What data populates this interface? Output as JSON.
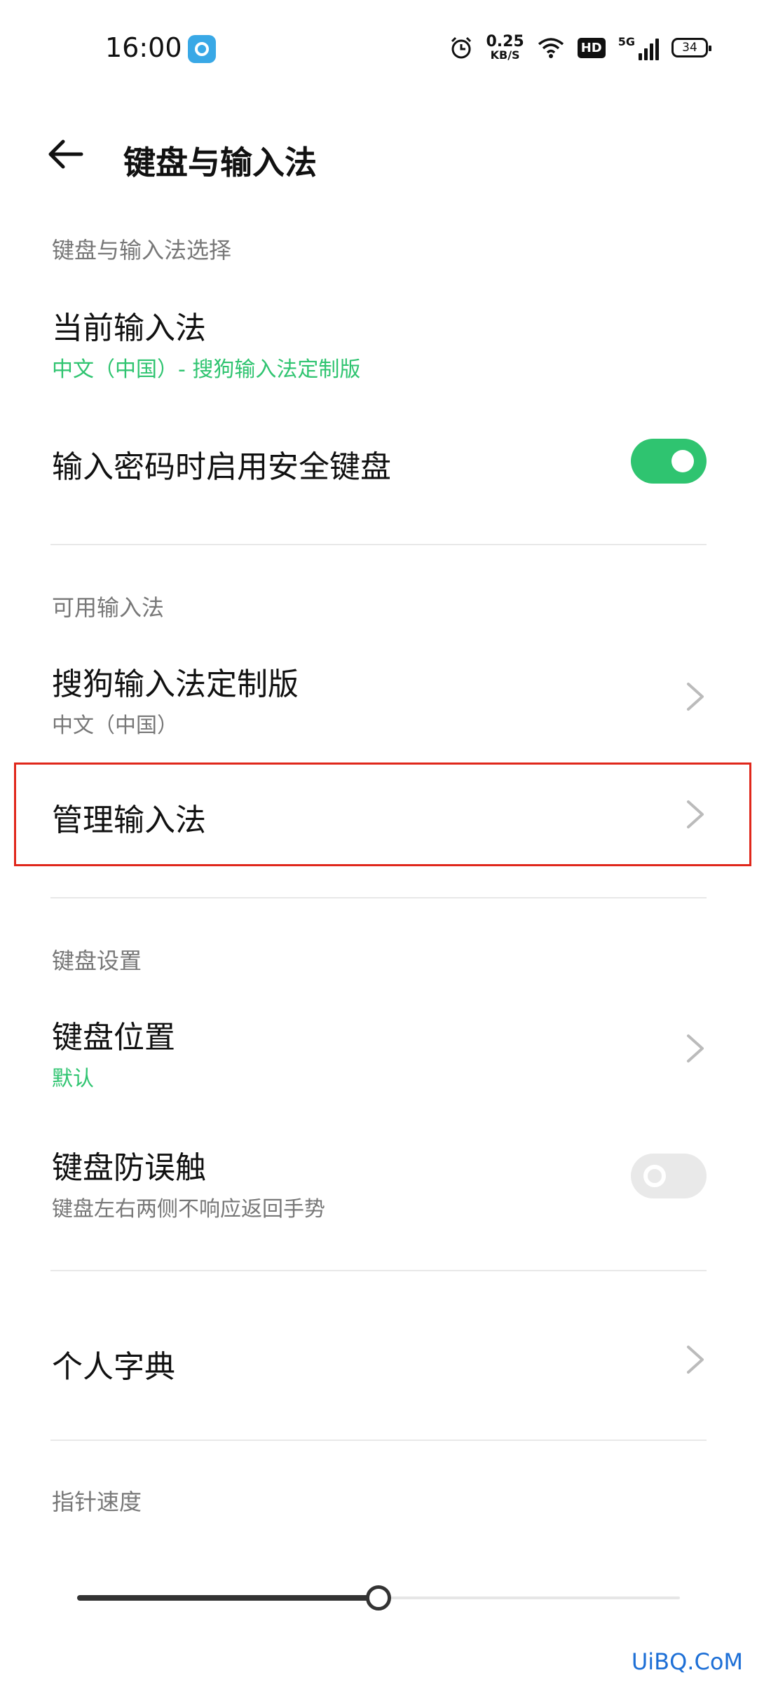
{
  "status_bar": {
    "time": "16:00",
    "net_speed_value": "0.25",
    "net_speed_unit": "KB/S",
    "hd_badge": "HD",
    "network_type": "5G",
    "battery": "34",
    "icons": [
      "alarm-icon",
      "wifi-icon",
      "hd-icon",
      "signal-icon",
      "battery-icon"
    ]
  },
  "header": {
    "title": "键盘与输入法"
  },
  "section_select": {
    "header": "键盘与输入法选择",
    "current_ime": {
      "title": "当前输入法",
      "subtitle": "中文（中国）- 搜狗输入法定制版"
    },
    "secure_keyboard": {
      "title": "输入密码时启用安全键盘",
      "enabled": true
    }
  },
  "section_available": {
    "header": "可用输入法",
    "sogou": {
      "title": "搜狗输入法定制版",
      "subtitle": "中文（中国）"
    },
    "manage": {
      "title": "管理输入法"
    }
  },
  "section_keyboard": {
    "header": "键盘设置",
    "position": {
      "title": "键盘位置",
      "subtitle": "默认"
    },
    "anti_touch": {
      "title": "键盘防误触",
      "subtitle": "键盘左右两侧不响应返回手势",
      "enabled": false
    }
  },
  "personal_dict": {
    "title": "个人字典"
  },
  "pointer_speed": {
    "header": "指针速度",
    "value_fraction": 0.5
  },
  "watermark": "UiBQ.CoM",
  "colors": {
    "accent": "#2fc470",
    "highlight": "#e0271b",
    "watermark": "#1d6fd6"
  }
}
